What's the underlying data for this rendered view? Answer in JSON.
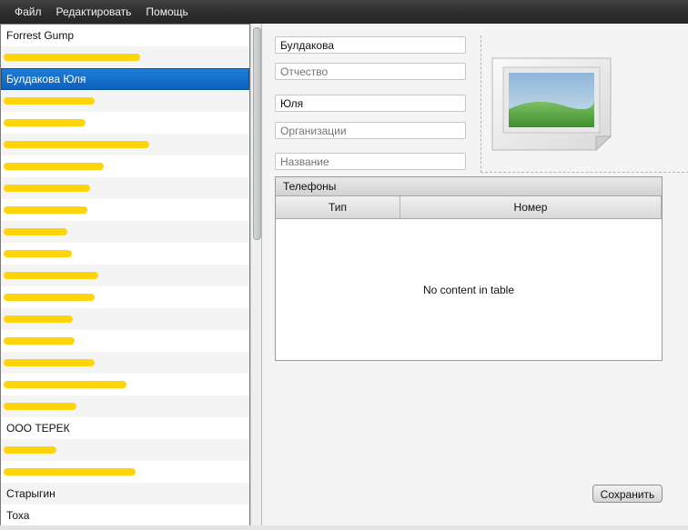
{
  "menu": {
    "items": [
      {
        "label": "Файл"
      },
      {
        "label": "Редактировать"
      },
      {
        "label": "Помощь"
      }
    ]
  },
  "contacts": {
    "items": [
      {
        "label": "Forrest Gump",
        "redacted": false
      },
      {
        "label": "",
        "redacted": true
      },
      {
        "label": "Булдакова Юля",
        "redacted": false,
        "selected": true
      },
      {
        "label": "",
        "redacted": true
      },
      {
        "label": "",
        "redacted": true
      },
      {
        "label": "",
        "redacted": true
      },
      {
        "label": "",
        "redacted": true
      },
      {
        "label": "",
        "redacted": true
      },
      {
        "label": "",
        "redacted": true
      },
      {
        "label": "",
        "redacted": true
      },
      {
        "label": "",
        "redacted": true
      },
      {
        "label": "",
        "redacted": true
      },
      {
        "label": "",
        "redacted": true
      },
      {
        "label": "",
        "redacted": true
      },
      {
        "label": "",
        "redacted": true
      },
      {
        "label": "",
        "redacted": true
      },
      {
        "label": "",
        "redacted": true
      },
      {
        "label": "",
        "redacted": true
      },
      {
        "label": "ООО ТЕРЕК",
        "redacted": false
      },
      {
        "label": "",
        "redacted": true
      },
      {
        "label": "",
        "redacted": true
      },
      {
        "label": "Старыгин",
        "redacted": false
      },
      {
        "label": "Тоха",
        "redacted": false
      }
    ]
  },
  "form": {
    "last_name": {
      "value": "Булдакова",
      "placeholder": ""
    },
    "middle_name": {
      "value": "",
      "placeholder": "Отчество"
    },
    "first_name": {
      "value": "Юля",
      "placeholder": ""
    },
    "organization": {
      "value": "",
      "placeholder": "Организации"
    },
    "title": {
      "value": "",
      "placeholder": "Название"
    }
  },
  "phones": {
    "title": "Телефоны",
    "columns": [
      {
        "label": "Тип"
      },
      {
        "label": "Номер"
      }
    ],
    "empty_text": "No content in table"
  },
  "actions": {
    "save_label": "Сохранить"
  },
  "colors": {
    "selection": "#0b61bd",
    "redaction": "#ffd200",
    "menubar": "#2d2d2d"
  }
}
